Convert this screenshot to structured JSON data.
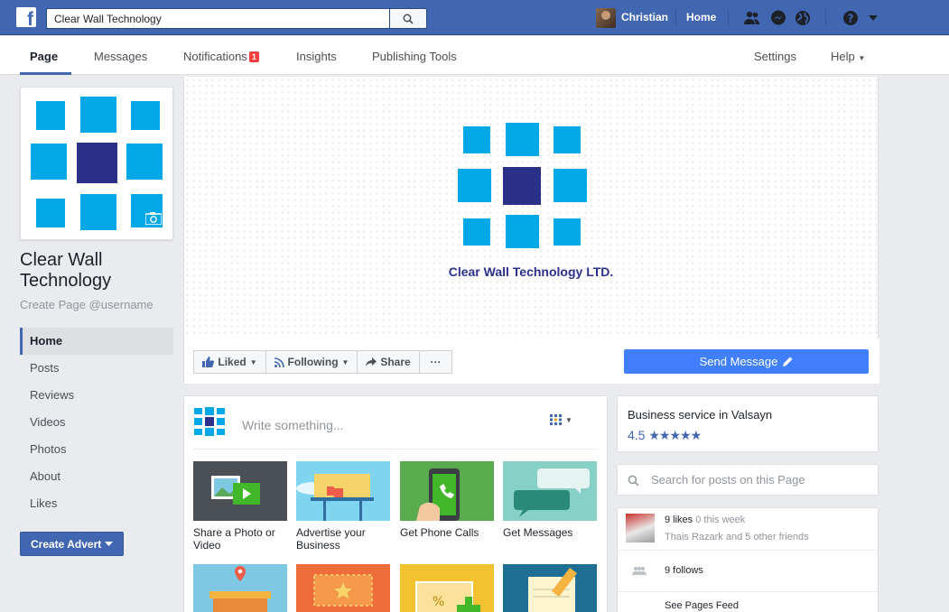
{
  "topbar": {
    "logo_glyph": "f",
    "search_value": "Clear Wall Technology",
    "user_name": "Christian",
    "home_label": "Home",
    "icons": [
      "friends-icon",
      "messenger-icon",
      "globe-icon",
      "help-icon",
      "caret-down-icon"
    ]
  },
  "tabs": {
    "page": "Page",
    "messages": "Messages",
    "notifications": "Notifications",
    "notifications_count": "1",
    "insights": "Insights",
    "publishing_tools": "Publishing Tools",
    "settings": "Settings",
    "help": "Help"
  },
  "page": {
    "name": "Clear Wall Technology",
    "username_prompt": "Create Page @username"
  },
  "nav": {
    "items": [
      {
        "label": "Home",
        "active": true
      },
      {
        "label": "Posts"
      },
      {
        "label": "Reviews"
      },
      {
        "label": "Videos"
      },
      {
        "label": "Photos"
      },
      {
        "label": "About"
      },
      {
        "label": "Likes"
      }
    ],
    "create_advert": "Create Advert"
  },
  "cover": {
    "logo_text": "Clear Wall Technology LTD.",
    "liked_label": "Liked",
    "following_label": "Following",
    "share_label": "Share",
    "more_label": "···",
    "send_message_label": "Send Message"
  },
  "composer": {
    "placeholder": "Write something...",
    "tiles": [
      {
        "label": "Share a Photo or Video"
      },
      {
        "label": "Advertise your Business"
      },
      {
        "label": "Get Phone Calls"
      },
      {
        "label": "Get Messages"
      }
    ]
  },
  "right": {
    "category": "Business service in Valsayn",
    "rating_value": "4.5",
    "rating_stars": "★★★★★",
    "search_placeholder": "Search for posts on this Page",
    "likes_count": "9 likes",
    "likes_week": "0 this week",
    "friends_name": "Thais Razark",
    "friends_rest": "and 5 other friends",
    "follows": "9 follows",
    "see_feed": "See Pages Feed"
  },
  "colors": {
    "brand_blue": "#4267b2",
    "logo_cyan": "#03a9e6",
    "logo_navy": "#2b3189",
    "send_button": "#4080ff",
    "badge_red": "#fa3e3e"
  }
}
